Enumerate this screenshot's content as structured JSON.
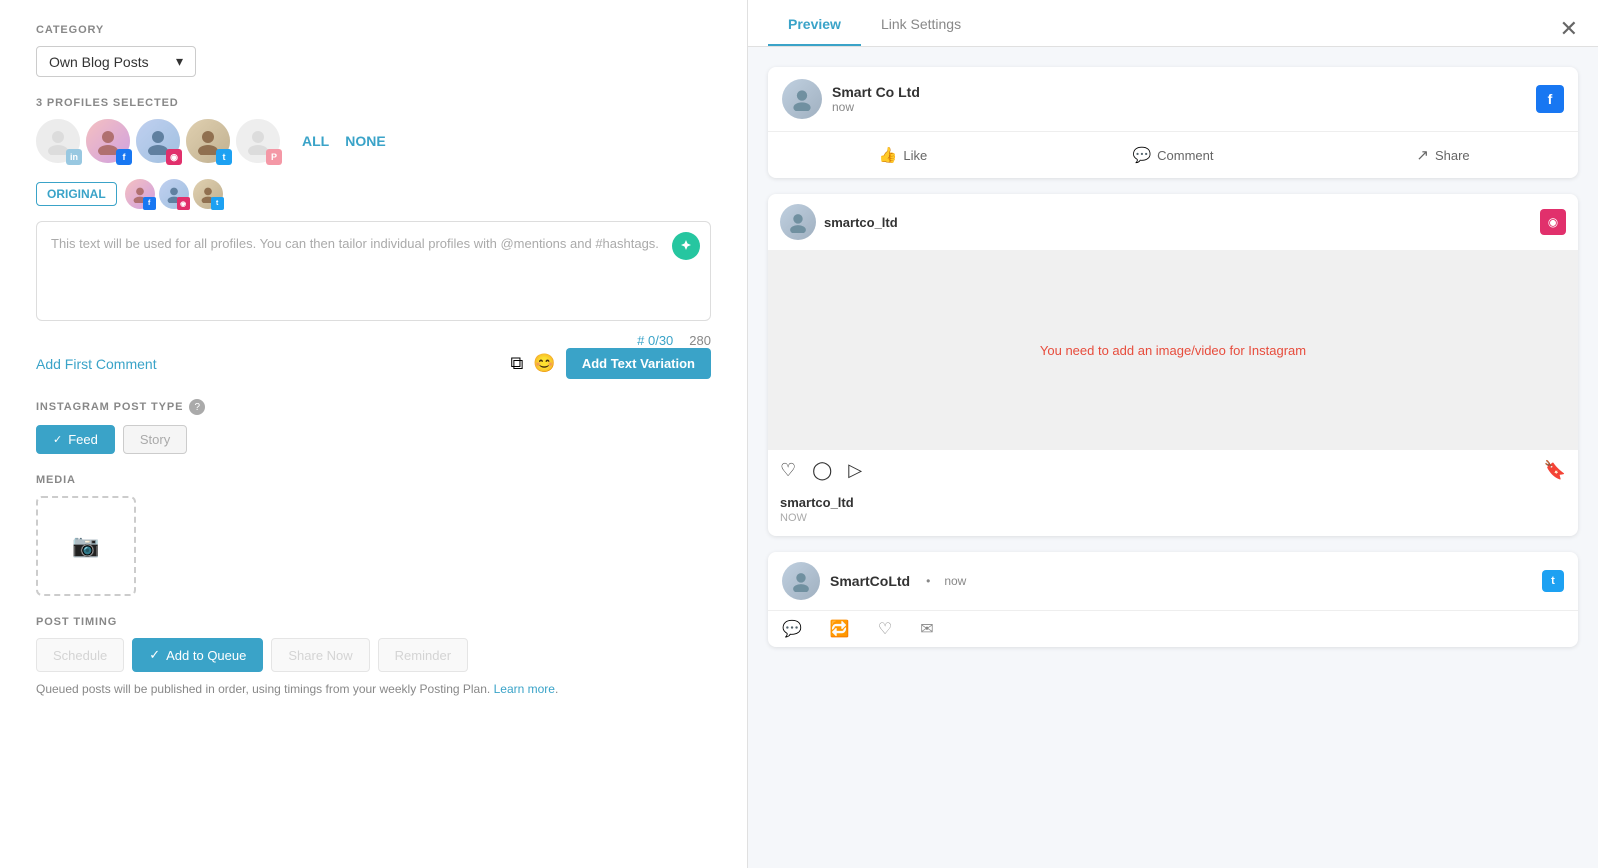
{
  "left": {
    "category_label": "CATEGORY",
    "category_value": "Own Blog Posts",
    "category_arrow": "▾",
    "profiles_label": "3 PROFILES SELECTED",
    "all_btn": "ALL",
    "none_btn": "NONE",
    "original_tab": "ORIGINAL",
    "text_placeholder": "This text will be used for all profiles. You can then tailor individual profiles with @mentions and #hashtags.",
    "hashtag_count": "# 0/30",
    "char_count": "280",
    "add_first_comment": "Add First Comment",
    "add_variation_btn": "Add Text Variation",
    "instagram_type_label": "INSTAGRAM POST TYPE",
    "feed_btn": "Feed",
    "story_btn": "Story",
    "media_label": "MEDIA",
    "timing_label": "POST TIMING",
    "add_to_queue_btn": "Add to Queue",
    "queued_note": "Queued posts will be published in order, using timings from your weekly Posting Plan.",
    "learn_more": "Learn more"
  },
  "right": {
    "preview_tab": "Preview",
    "link_settings_tab": "Link Settings",
    "close_icon": "✕",
    "fb_card": {
      "name": "Smart Co Ltd",
      "time": "now",
      "social": "f",
      "like": "Like",
      "comment": "Comment",
      "share": "Share"
    },
    "ig_card": {
      "username": "smartco_ltd",
      "warning": "You need to add an image/video for Instagram",
      "footer_user": "smartco_ltd",
      "footer_time": "NOW"
    },
    "tw_card": {
      "name": "SmartCoLtd",
      "dot": "•",
      "time": "now"
    }
  }
}
